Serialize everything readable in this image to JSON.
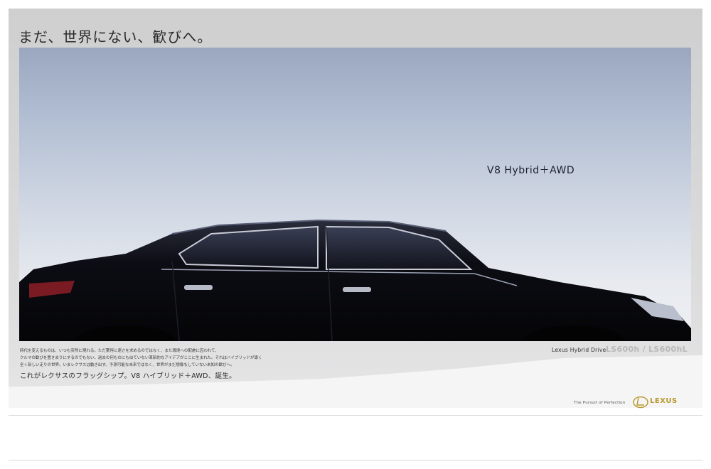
{
  "headline": "まだ、世界にない、歓びへ。",
  "tagline": "V8 Hybrid＋AWD",
  "body_copy": [
    "時代を変えるものは、いつも突然に現れる。ただ驚愕に速さを求めるのではなく、また環境への配慮に囚われて、",
    "クルマの歓びを置き去りにするのでもない。過去の何ものにも似ていない革新的なアイデアがここに生まれた。それはハイブリッドが導く",
    "全く新しい走りの世界。いまレクサスは動き出す。予測可能な未来ではなく、世界がまだ想像もしていない未知の歓びへ。"
  ],
  "subhead": "これがレクサスのフラッグシップ。V8 ハイブリッド＋AWD、誕生。",
  "drive_label": "Lexus Hybrid Drive",
  "models": "LS600h / LS600hL",
  "pursuit": "The Pursuit of Perfection",
  "brand": "LEXUS",
  "colors": {
    "brand_gold": "#b89a2e",
    "car_body": "#0c0d14"
  }
}
